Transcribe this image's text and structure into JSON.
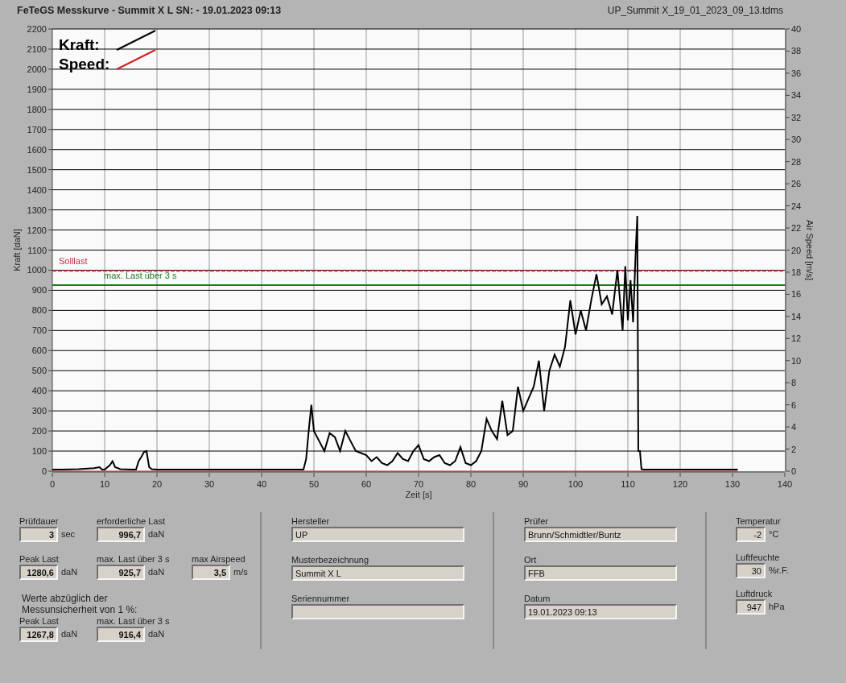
{
  "header": {
    "title": "FeTeGS Messkurve - Summit X L  SN:  - 19.01.2023 09:13",
    "file": "UP_Summit X_19_01_2023_09_13.tdms"
  },
  "chart": {
    "chart_data": {
      "type": "line",
      "xlabel": "Zeit [s]",
      "ylabel": "Kraft [daN]",
      "y2label": "Air Speed [m/s]",
      "xlim": [
        0,
        140
      ],
      "ylim": [
        0,
        2200
      ],
      "y2lim": [
        0,
        40
      ],
      "xticks": [
        0,
        10,
        20,
        30,
        40,
        50,
        60,
        70,
        80,
        90,
        100,
        110,
        120,
        130,
        140
      ],
      "yticks": [
        0,
        100,
        200,
        300,
        400,
        500,
        600,
        700,
        800,
        900,
        1000,
        1100,
        1200,
        1300,
        1400,
        1500,
        1600,
        1700,
        1800,
        1900,
        2000,
        2100,
        2200
      ],
      "y2ticks": [
        0,
        2,
        4,
        6,
        8,
        10,
        12,
        14,
        16,
        18,
        20,
        22,
        24,
        26,
        28,
        30,
        32,
        34,
        36,
        38,
        40
      ],
      "x": [
        0,
        2,
        5,
        8,
        9,
        9.5,
        10,
        11,
        11.5,
        12,
        13,
        15,
        16,
        16.5,
        17,
        17.5,
        18,
        18.5,
        19,
        20,
        30,
        40,
        47,
        48,
        48.5,
        49,
        49.5,
        50,
        51,
        52,
        53,
        54,
        55,
        56,
        57,
        58,
        59,
        60,
        61,
        62,
        63,
        64,
        65,
        66,
        67,
        68,
        69,
        70,
        71,
        72,
        73,
        74,
        75,
        76,
        77,
        78,
        79,
        80,
        81,
        82,
        83,
        84,
        85,
        86,
        87,
        88,
        89,
        90,
        91,
        92,
        93,
        94,
        95,
        96,
        97,
        98,
        99,
        100,
        101,
        102,
        103,
        104,
        105,
        106,
        107,
        108,
        109,
        109.5,
        110,
        110.5,
        111,
        111.5,
        111.8,
        112,
        112.3,
        112.6,
        113,
        120,
        131
      ],
      "series": [
        {
          "name": "Kraft:",
          "color": "#000000",
          "values": [
            8,
            8,
            10,
            15,
            20,
            8,
            8,
            30,
            50,
            20,
            10,
            8,
            8,
            50,
            70,
            95,
            100,
            20,
            10,
            8,
            8,
            8,
            8,
            8,
            60,
            200,
            330,
            200,
            150,
            100,
            190,
            170,
            100,
            200,
            150,
            100,
            90,
            80,
            50,
            70,
            40,
            30,
            50,
            90,
            60,
            50,
            100,
            130,
            60,
            50,
            70,
            80,
            40,
            30,
            50,
            120,
            40,
            30,
            50,
            100,
            260,
            200,
            160,
            350,
            180,
            200,
            420,
            300,
            360,
            420,
            550,
            300,
            500,
            580,
            520,
            620,
            850,
            680,
            800,
            700,
            850,
            980,
            830,
            870,
            780,
            1000,
            700,
            1020,
            750,
            950,
            740,
            1100,
            1270,
            100,
            100,
            10,
            8,
            8,
            8
          ]
        },
        {
          "name": "Speed:",
          "color": "#d02020",
          "axis": "y2",
          "values": [
            0,
            0,
            0,
            0,
            0,
            0,
            0,
            0,
            0,
            0,
            0,
            0,
            0,
            0,
            0,
            0,
            0,
            0,
            0,
            0,
            0,
            0,
            0,
            0,
            0,
            0,
            0,
            0,
            0,
            0,
            0,
            0,
            0,
            0,
            0,
            0,
            0,
            0,
            0,
            0,
            0,
            0,
            0,
            0,
            0,
            0,
            0,
            0,
            0,
            0,
            0,
            0,
            0,
            0,
            0,
            0,
            0,
            0,
            0,
            0,
            0,
            0,
            0,
            0,
            0,
            0,
            0,
            0,
            0,
            0,
            0,
            0,
            0,
            0,
            0,
            0,
            0,
            0,
            0,
            0,
            0,
            0,
            0,
            0,
            0,
            0,
            0,
            0,
            0,
            0,
            0,
            0,
            0,
            0,
            0,
            0,
            0,
            0,
            0
          ]
        }
      ],
      "ref_lines": [
        {
          "axis": "y",
          "label": "Solllast",
          "value": 996.7,
          "color": "#c03040"
        },
        {
          "axis": "y",
          "label": "max. Last über 3 s",
          "value": 925.7,
          "color": "#1e7a1e"
        }
      ],
      "grid": true,
      "legend": true
    }
  },
  "results": [
    {
      "label": "Prüfdauer",
      "value": "3",
      "unit": "sec"
    },
    {
      "label": "erforderliche Last",
      "value": "996,7",
      "unit": "daN"
    },
    {
      "label": "Peak Last",
      "value": "1280,6",
      "unit": "daN"
    },
    {
      "label": "max. Last über 3 s",
      "value": "925,7",
      "unit": "daN"
    },
    {
      "label": "max Airspeed",
      "value": "3,5",
      "unit": "m/s"
    }
  ],
  "reduced": {
    "note": "Werte abzüglich der Messunsicherheit von 1 %:",
    "fields": [
      {
        "label": "Peak Last",
        "value": "1267,8",
        "unit": "daN"
      },
      {
        "label": "max. Last über 3 s",
        "value": "916,4",
        "unit": "daN"
      }
    ]
  },
  "info_left": [
    {
      "label": "Hersteller",
      "value": "UP"
    },
    {
      "label": "Musterbezeichnung",
      "value": "Summit X L"
    },
    {
      "label": "Seriennummer"
    }
  ],
  "info_mid": [
    {
      "label": "Prüfer",
      "value": "Brunn/Schmidtler/Buntz"
    },
    {
      "label": "Ort",
      "value": "FFB"
    },
    {
      "label": "Datum",
      "value": "19.01.2023 09:13"
    }
  ],
  "conditions": [
    {
      "label": "Temperatur",
      "value": "-2",
      "unit": "°C"
    },
    {
      "label": "Luftfeuchte",
      "value": "30",
      "unit": "%r.F."
    },
    {
      "label": "Luftdruck",
      "value": "947",
      "unit": "hPa"
    }
  ]
}
